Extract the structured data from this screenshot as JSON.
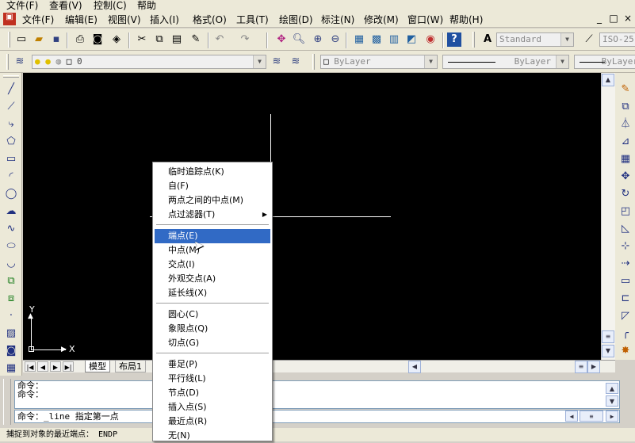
{
  "outer_menu": [
    "文件(F)",
    "查看(V)",
    "控制(C)",
    "帮助"
  ],
  "menubar": [
    "文件(F)",
    "编辑(E)",
    "视图(V)",
    "插入(I)",
    "格式(O)",
    "工具(T)",
    "绘图(D)",
    "标注(N)",
    "修改(M)",
    "窗口(W)",
    "帮助(H)"
  ],
  "window_buttons": [
    "_",
    "□",
    "×"
  ],
  "toolbar": {
    "text_style": "Standard",
    "dim_style": "ISO-25",
    "layer": "0",
    "color": "ByLayer",
    "linetype": "ByLayer",
    "lineweight": "ByLayer"
  },
  "ucs": {
    "y_label": "Y",
    "x_label": "X"
  },
  "tabs": [
    "模型",
    "布局1"
  ],
  "command": {
    "history": [
      "命令：",
      "命令："
    ],
    "current": "命令：_line 指定第一点"
  },
  "status_text": "捕捉到对象的最近端点： ENDP",
  "context_menu": {
    "group1": [
      "临时追踪点(K)",
      "自(F)",
      "两点之间的中点(M)",
      "点过滤器(T)"
    ],
    "group2": [
      "端点(E)",
      "中点(M)",
      "交点(I)",
      "外观交点(A)",
      "延长线(X)"
    ],
    "group3": [
      "圆心(C)",
      "象限点(Q)",
      "切点(G)"
    ],
    "group4": [
      "垂足(P)",
      "平行线(L)",
      "节点(D)",
      "插入点(S)",
      "最近点(R)",
      "无(N)"
    ],
    "highlighted": "端点(E)",
    "colors": {
      "highlight": "#316ac5"
    }
  },
  "icons": {
    "left": [
      "line-icon",
      "construction-line-icon",
      "polyline-icon",
      "polygon-icon",
      "rectangle-icon",
      "arc-icon",
      "circle-icon",
      "revision-cloud-icon",
      "spline-icon",
      "ellipse-icon",
      "ellipse-arc-icon",
      "insert-block-icon",
      "make-block-icon",
      "point-icon",
      "hatch-icon",
      "region-icon",
      "table-icon"
    ],
    "right": [
      "erase-icon",
      "copy-icon",
      "mirror-icon",
      "offset-icon",
      "array-icon",
      "move-icon",
      "rotate-icon",
      "scale-icon",
      "stretch-icon",
      "trim-icon",
      "extend-icon",
      "break-at-point-icon",
      "break-icon",
      "chamfer-icon",
      "fillet-icon",
      "explode-icon"
    ]
  }
}
